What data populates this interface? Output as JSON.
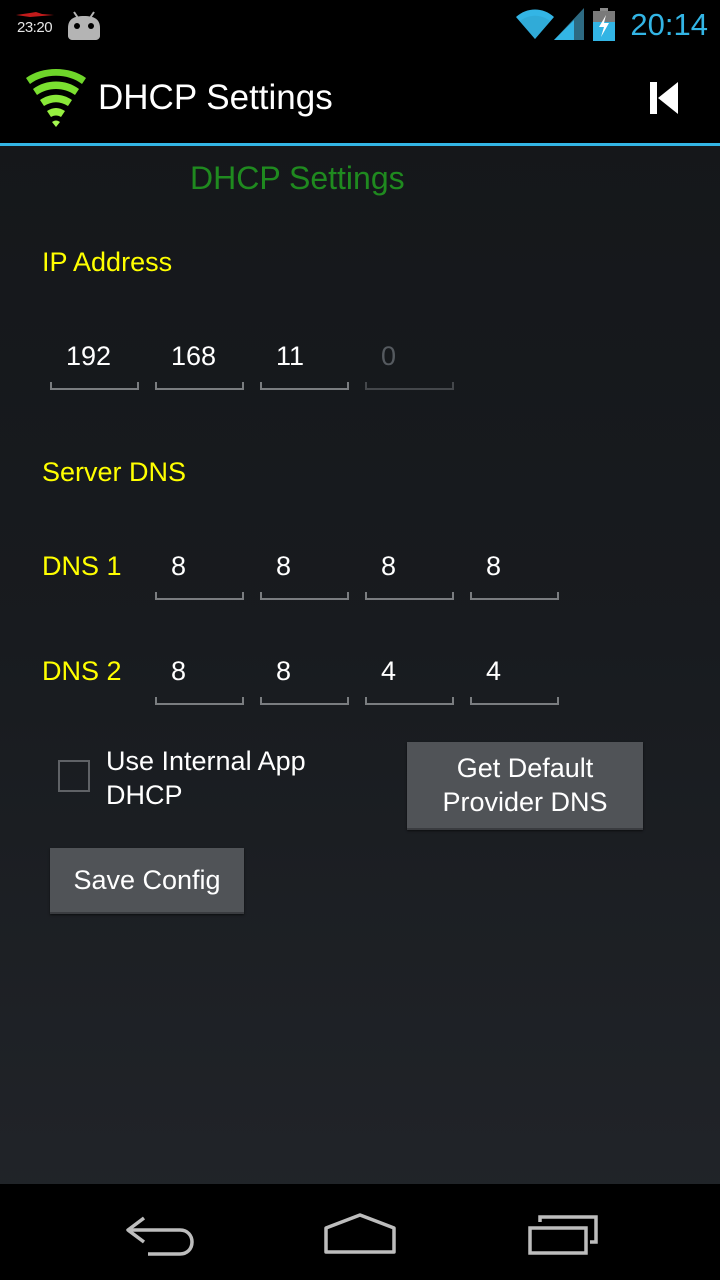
{
  "status_bar": {
    "left_clock": "23:20",
    "clock": "20:14"
  },
  "action_bar": {
    "title": "DHCP Settings"
  },
  "main": {
    "heading": "DHCP Settings",
    "ip_section": {
      "label": "IP Address",
      "octets": [
        "192",
        "168",
        "11",
        ""
      ],
      "placeholders": [
        "",
        "",
        "",
        "0"
      ]
    },
    "dns_section": {
      "label": "Server DNS",
      "dns1": {
        "label": "DNS 1",
        "octets": [
          "8",
          "8",
          "8",
          "8"
        ]
      },
      "dns2": {
        "label": "DNS 2",
        "octets": [
          "8",
          "8",
          "4",
          "4"
        ]
      }
    },
    "use_internal_label": "Use Internal App DHCP",
    "use_internal_checked": false,
    "get_default_button": "Get Default Provider DNS",
    "save_button": "Save Config"
  },
  "colors": {
    "accent": "#33b5e5",
    "heading": "#1f8a1f",
    "label": "#ffff00"
  },
  "icons": {
    "logo": "wifi-signal-icon",
    "action": "skip-previous-icon",
    "nav": [
      "back-icon",
      "home-icon",
      "recents-icon"
    ]
  }
}
